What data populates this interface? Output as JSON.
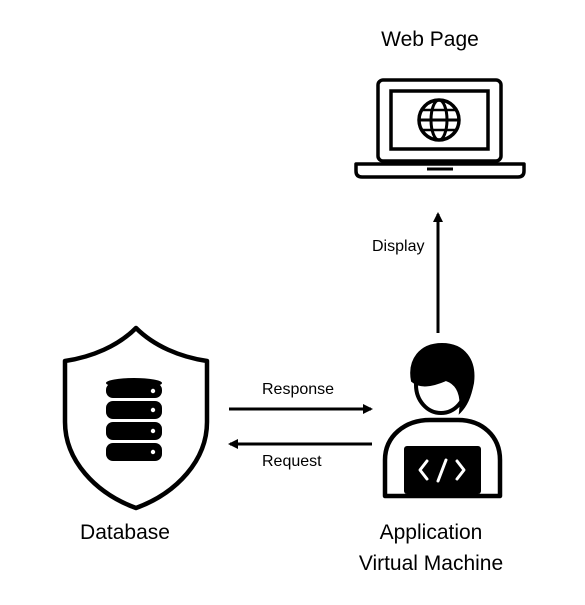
{
  "nodes": {
    "web_page": {
      "label": "Web Page",
      "icon": "laptop-globe-icon"
    },
    "database": {
      "label": "Database",
      "icon": "shield-database-icon"
    },
    "application": {
      "label_line1": "Application",
      "label_line2": "Virtual Machine",
      "icon": "developer-laptop-icon"
    }
  },
  "edges": {
    "display": "Display",
    "response": "Response",
    "request": "Request"
  },
  "colors": {
    "stroke": "#000000",
    "background": "#ffffff"
  }
}
